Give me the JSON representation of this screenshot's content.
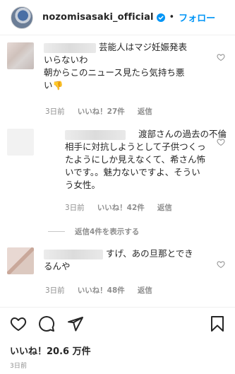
{
  "header": {
    "username": "nozomisasaki_official",
    "separator": "•",
    "follow_label": "フォロー"
  },
  "comments": [
    {
      "text_lines": [
        "芸能人はマジ妊娠発表",
        "いらないわ",
        "朝からこのニュース見たら気持ち悪",
        "い"
      ],
      "emoji": "👎",
      "time": "3日前",
      "likes": "いいね！27件",
      "reply": "返信"
    },
    {
      "text_lines": [
        "渡部さんの過去の不倫",
        "相手に対抗しようとして子供つくっ",
        "たようにしか見えなくて、希さん怖",
        "いです。。魅力ないですよ、そうい",
        "う女性。"
      ],
      "time": "3日前",
      "likes": "いいね！42件",
      "reply": "返信"
    },
    {
      "text_lines": [
        "すげ、あの旦那とでき",
        "るんや"
      ],
      "time": "3日前",
      "likes": "いいね！48件",
      "reply": "返信"
    }
  ],
  "view_replies_label": "返信4件を表示する",
  "likes_total": "いいね！20.6 万件",
  "post_time": "3日前",
  "colors": {
    "accent": "#0095f6",
    "secondary_text": "#8e8e8e",
    "primary_text": "#262626"
  }
}
